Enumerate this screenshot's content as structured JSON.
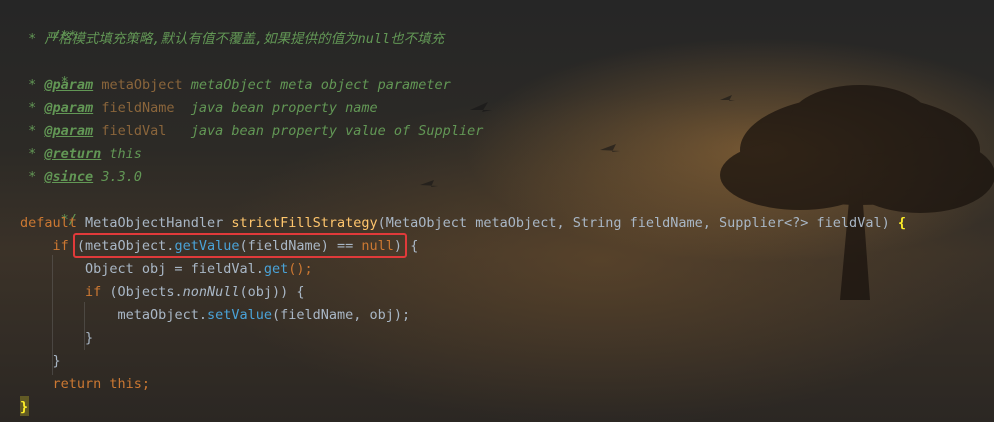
{
  "comment": {
    "open": "/**",
    "desc_star": " * ",
    "desc": "严格模式填充策略,默认有值不覆盖,如果提供的值为null也不填充",
    "blank": " *",
    "param1": {
      "star": " * ",
      "tag": "@param",
      "name": "metaObject",
      "text": " metaObject meta object parameter"
    },
    "param2": {
      "star": " * ",
      "tag": "@param",
      "name": "fieldName",
      "text": "  java bean property name"
    },
    "param3": {
      "star": " * ",
      "tag": "@param",
      "name": "fieldVal",
      "text": "   java bean property value of Supplier"
    },
    "return": {
      "star": " * ",
      "tag": "@return",
      "text": " this"
    },
    "since": {
      "star": " * ",
      "tag": "@since",
      "text": " 3.3.0"
    },
    "close": " */"
  },
  "sig": {
    "kw": "default",
    "type": " MetaObjectHandler ",
    "method": "strictFillStrategy",
    "params": "(MetaObject metaObject, String fieldName, Supplier<?> fieldVal) ",
    "brace": "{"
  },
  "if1": {
    "kw": "if ",
    "a": "(metaObject.",
    "call": "getValue",
    "b": "(fieldName) == ",
    "null": "null",
    "c": ") ",
    "brace": "{"
  },
  "decl": {
    "a": "Object obj = fieldVal.",
    "call": "get",
    "b": "();"
  },
  "if2": {
    "kw": "if ",
    "a": "(Objects.",
    "stat": "nonNull",
    "b": "(obj)) {"
  },
  "set": {
    "a": "metaObject.",
    "call": "setValue",
    "b": "(fieldName, obj);"
  },
  "close_inner": "}",
  "close_if": "}",
  "ret": {
    "kw": "return this",
    "semi": ";"
  },
  "close_method": "}"
}
